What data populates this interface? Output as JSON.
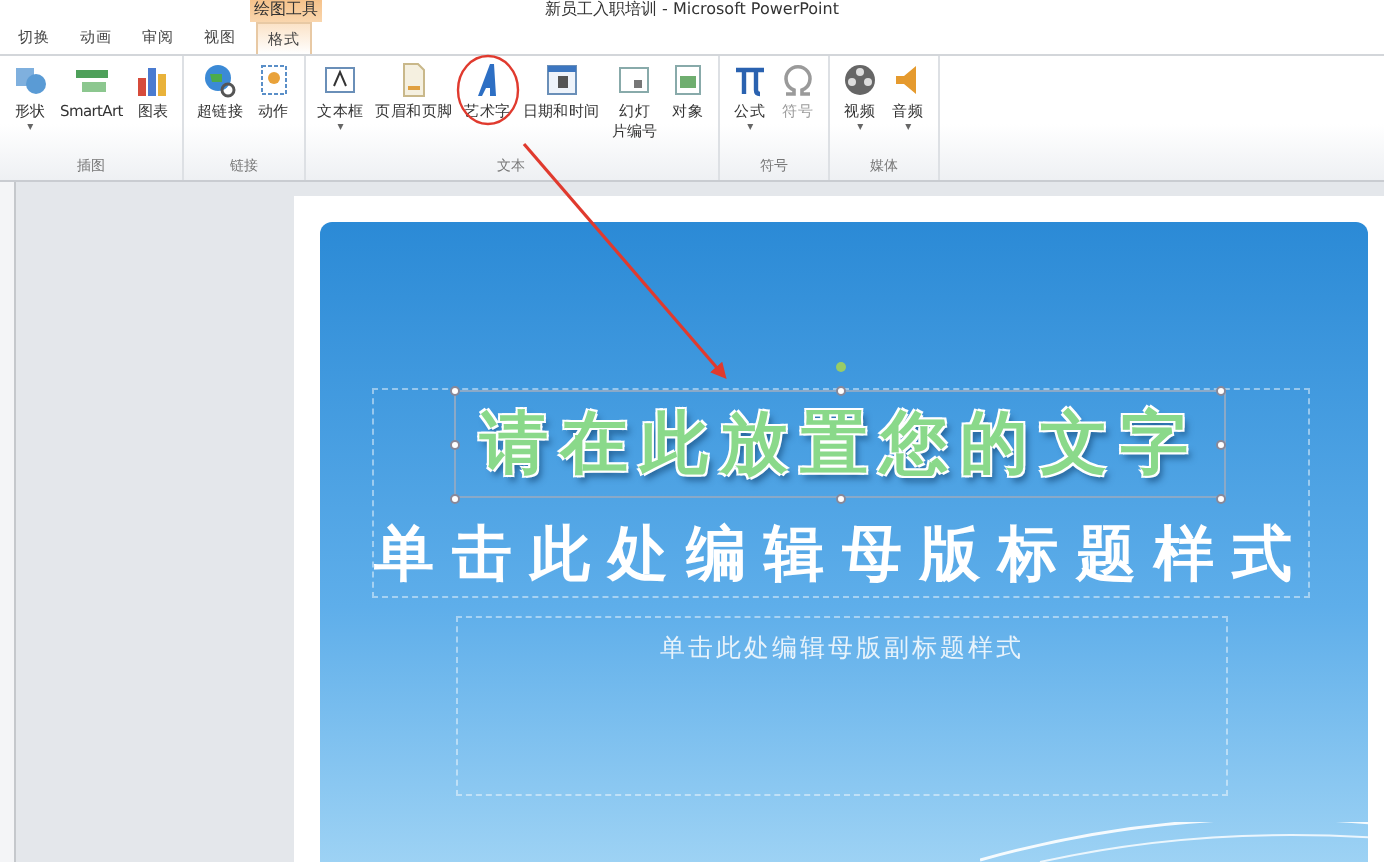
{
  "window": {
    "title": "新员工入职培训 - Microsoft PowerPoint"
  },
  "contextual_tab": {
    "label": "绘图工具"
  },
  "tabs": [
    {
      "label": "切换",
      "selected": false
    },
    {
      "label": "动画",
      "selected": false
    },
    {
      "label": "审阅",
      "selected": false
    },
    {
      "label": "视图",
      "selected": false
    },
    {
      "label": "格式",
      "selected": true
    }
  ],
  "ribbon_groups": [
    {
      "label": "插图",
      "items": [
        {
          "label": "形状",
          "caret": "▾",
          "disabled": false
        },
        {
          "label": "SmartArt",
          "disabled": false
        },
        {
          "label": "图表",
          "disabled": false
        }
      ]
    },
    {
      "label": "链接",
      "items": [
        {
          "label": "超链接",
          "disabled": false
        },
        {
          "label": "动作",
          "disabled": false
        }
      ]
    },
    {
      "label": "文本",
      "items": [
        {
          "label": "文本框",
          "caret": "▾",
          "disabled": false
        },
        {
          "label": "页眉和页脚",
          "disabled": false
        },
        {
          "label": "艺术字",
          "disabled": false
        },
        {
          "label": "日期和时间",
          "disabled": false
        },
        {
          "label": [
            "幻灯",
            "片编号"
          ],
          "disabled": false
        },
        {
          "label": "对象",
          "disabled": false
        }
      ]
    },
    {
      "label": "符号",
      "items": [
        {
          "label": "公式",
          "caret": "▾",
          "disabled": false
        },
        {
          "label": "符号",
          "disabled": true
        }
      ]
    },
    {
      "label": "媒体",
      "items": [
        {
          "label": "视频",
          "caret": "▾",
          "disabled": false
        },
        {
          "label": "音频",
          "caret": "▾",
          "disabled": false
        }
      ]
    }
  ],
  "slide": {
    "wordart": "请在此放置您的文字",
    "title": "单击此处编辑母版标题样式",
    "subtitle": "单击此处编辑母版副标题样式"
  }
}
